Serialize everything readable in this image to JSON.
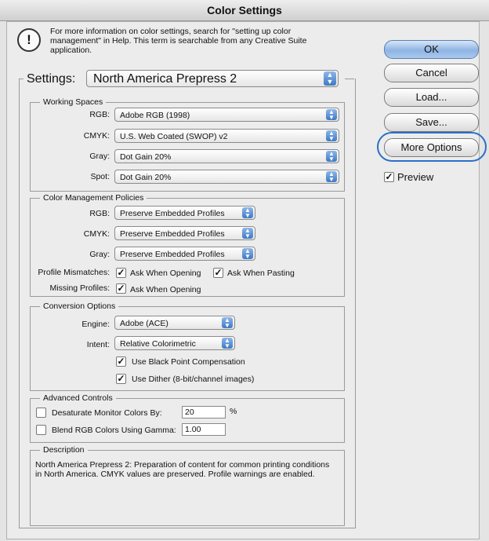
{
  "window": {
    "title": "Color Settings"
  },
  "info": {
    "icon": "exclamation-icon",
    "text": "For more information on color settings, search for \"setting up color management\" in Help. This term is searchable from any Creative Suite application."
  },
  "settings": {
    "label": "Settings:",
    "value": "North America Prepress 2"
  },
  "working_spaces": {
    "title": "Working Spaces",
    "rgb_label": "RGB:",
    "rgb_value": "Adobe RGB (1998)",
    "cmyk_label": "CMYK:",
    "cmyk_value": "U.S. Web Coated (SWOP) v2",
    "gray_label": "Gray:",
    "gray_value": "Dot Gain 20%",
    "spot_label": "Spot:",
    "spot_value": "Dot Gain 20%"
  },
  "policies": {
    "title": "Color Management Policies",
    "rgb_label": "RGB:",
    "rgb_value": "Preserve Embedded Profiles",
    "cmyk_label": "CMYK:",
    "cmyk_value": "Preserve Embedded Profiles",
    "gray_label": "Gray:",
    "gray_value": "Preserve Embedded Profiles",
    "mismatch_label": "Profile Mismatches:",
    "ask_opening": {
      "label": "Ask When Opening",
      "checked": true
    },
    "ask_pasting": {
      "label": "Ask When Pasting",
      "checked": true
    },
    "missing_label": "Missing Profiles:",
    "missing_ask_opening": {
      "label": "Ask When Opening",
      "checked": true
    }
  },
  "conversion": {
    "title": "Conversion Options",
    "engine_label": "Engine:",
    "engine_value": "Adobe (ACE)",
    "intent_label": "Intent:",
    "intent_value": "Relative Colorimetric",
    "black_point": {
      "label": "Use Black Point Compensation",
      "checked": true
    },
    "dither": {
      "label": "Use Dither (8-bit/channel images)",
      "checked": true
    }
  },
  "advanced": {
    "title": "Advanced Controls",
    "desaturate": {
      "label": "Desaturate Monitor Colors By:",
      "checked": false,
      "value": "20",
      "unit": "%"
    },
    "blend": {
      "label": "Blend RGB Colors Using Gamma:",
      "checked": false,
      "value": "1.00"
    }
  },
  "description": {
    "title": "Description",
    "text": "North America Prepress 2:  Preparation of content for common printing conditions in North America. CMYK values are preserved. Profile warnings are enabled."
  },
  "buttons": {
    "ok": "OK",
    "cancel": "Cancel",
    "load": "Load...",
    "save": "Save...",
    "more_options": "More Options"
  },
  "preview": {
    "label": "Preview",
    "checked": true
  },
  "colors": {
    "highlight": "#2a6fc9",
    "default_button": "#8fb4e2"
  }
}
